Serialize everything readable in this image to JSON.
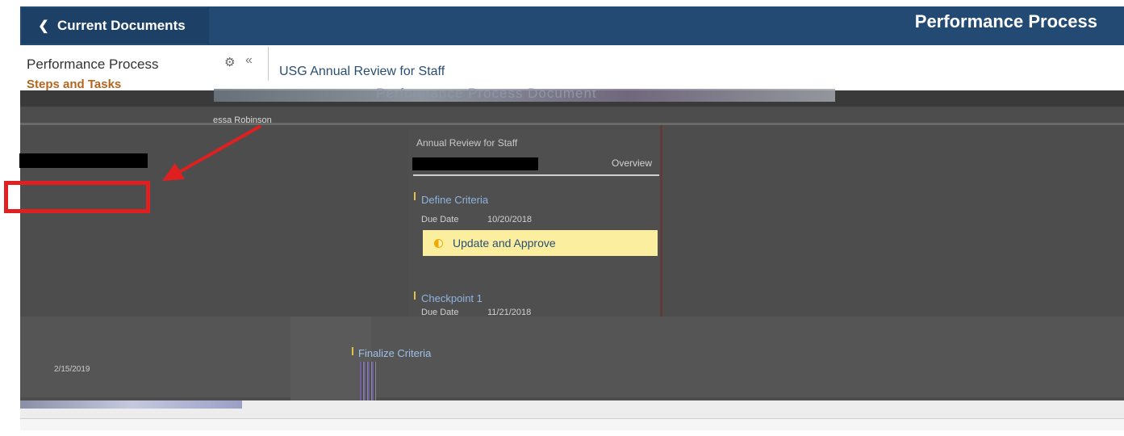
{
  "header": {
    "back_label": "Current Documents",
    "title": "Performance Process"
  },
  "left_panel": {
    "title": "Performance Process",
    "steps_label": "Steps and Tasks",
    "person": "essa Robinson"
  },
  "document": {
    "title": "USG Annual Review for Staff",
    "name": "Performance Process Document",
    "type_label": "Annual Review for Staff",
    "overview_label": "Overview"
  },
  "steps": [
    {
      "name": "Define Criteria",
      "due_label": "Due Date",
      "due_value": "10/20/2018",
      "task_label": "Update and Approve"
    },
    {
      "name": "Checkpoint 1",
      "due_label": "Due Date",
      "due_value": "11/21/2018"
    },
    {
      "name": "Finalize Criteria"
    }
  ],
  "lower": {
    "date_text": "2/15/2019"
  },
  "colors": {
    "header_bg": "#224a72",
    "highlight_box": "#e02020",
    "arrow": "#e02020",
    "task_bg": "#fbef9f",
    "steps_label": "#b5651d"
  }
}
